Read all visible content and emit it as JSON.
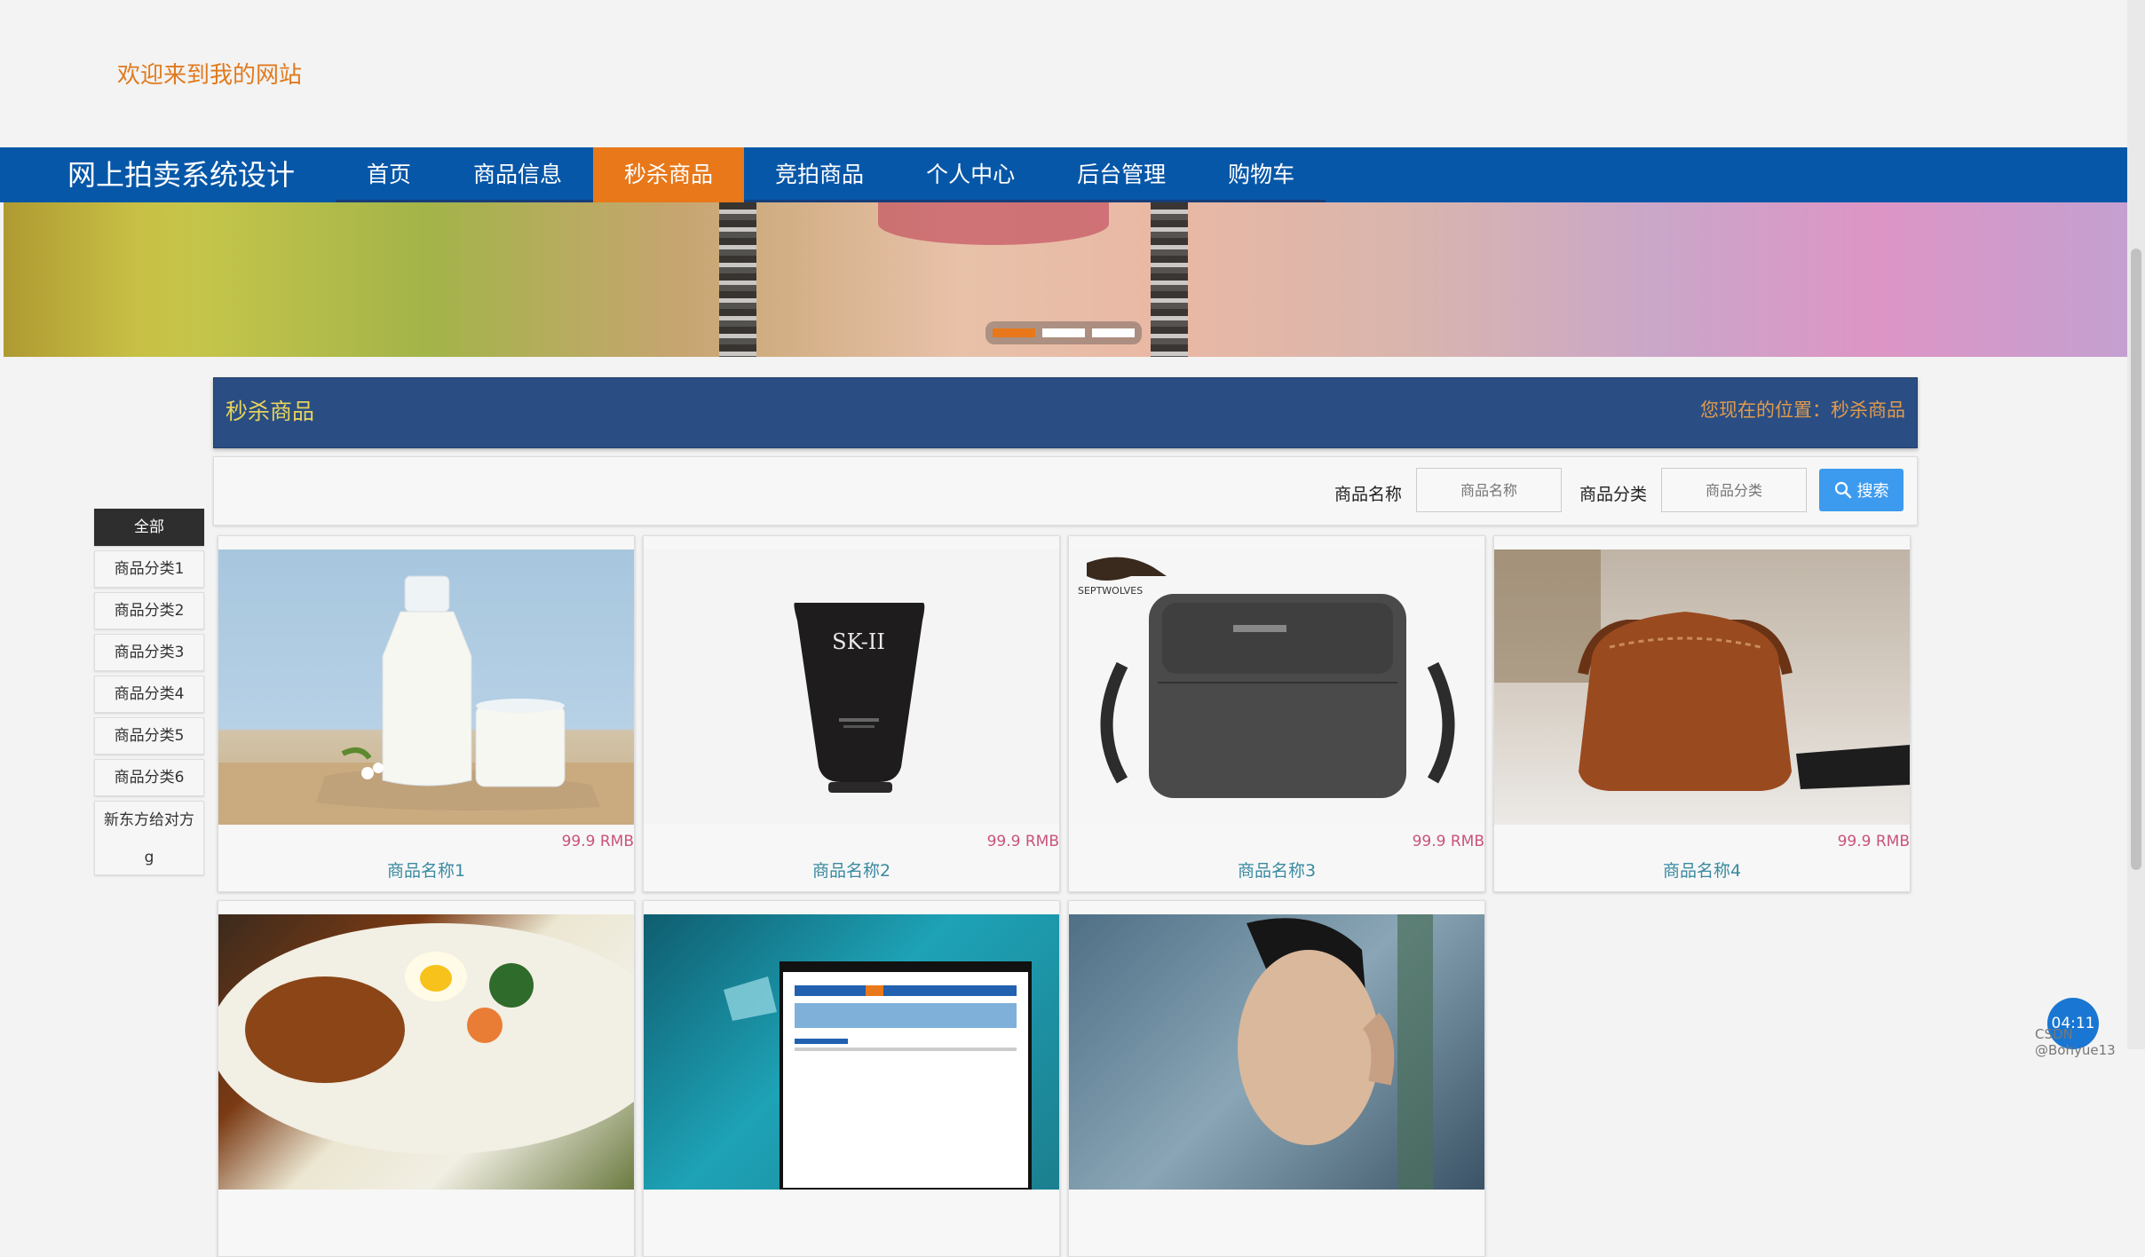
{
  "header": {
    "welcome": "欢迎来到我的网站"
  },
  "nav": {
    "brand": "网上拍卖系统设计",
    "items": [
      {
        "label": "首页",
        "active": false
      },
      {
        "label": "商品信息",
        "active": false
      },
      {
        "label": "秒杀商品",
        "active": true
      },
      {
        "label": "竞拍商品",
        "active": false
      },
      {
        "label": "个人中心",
        "active": false
      },
      {
        "label": "后台管理",
        "active": false
      },
      {
        "label": "购物车",
        "active": false
      }
    ]
  },
  "banner": {
    "slides": 3,
    "active_slide": 1
  },
  "section": {
    "title": "秒杀商品",
    "location": "您现在的位置：秒杀商品"
  },
  "search": {
    "name_label": "商品名称",
    "name_placeholder": "商品名称",
    "category_label": "商品分类",
    "category_placeholder": "商品分类",
    "button_label": "搜索"
  },
  "sidebar": {
    "categories": [
      "全部",
      "商品分类1",
      "商品分类2",
      "商品分类3",
      "商品分类4",
      "商品分类5",
      "商品分类6",
      "新东方给对方g"
    ]
  },
  "products": [
    {
      "name": "商品名称1",
      "price": "99.9 RMB",
      "image": "milk-bottle-glass"
    },
    {
      "name": "商品名称2",
      "price": "99.9 RMB",
      "image": "skii-tube",
      "image_text": "SK-II"
    },
    {
      "name": "商品名称3",
      "price": "99.9 RMB",
      "image": "septwolves-shoulder-bag",
      "image_text": "SEPTWOLVES"
    },
    {
      "name": "商品名称4",
      "price": "99.9 RMB",
      "image": "leather-bag"
    },
    {
      "name": "",
      "price": "",
      "image": "food-plate"
    },
    {
      "name": "",
      "price": "",
      "image": "website-screenshot"
    },
    {
      "name": "",
      "price": "",
      "image": "man-portrait"
    }
  ],
  "overlay": {
    "timer": "04:11",
    "watermark": "CSDN @Bohyue13"
  },
  "colors": {
    "nav_bg": "#0757a8",
    "nav_active": "#e8781a",
    "section_bg": "#2a4e83",
    "section_title": "#e7d35b",
    "search_button": "#3d9bef",
    "price": "#c9537a",
    "product_name": "#3a8aa0"
  }
}
